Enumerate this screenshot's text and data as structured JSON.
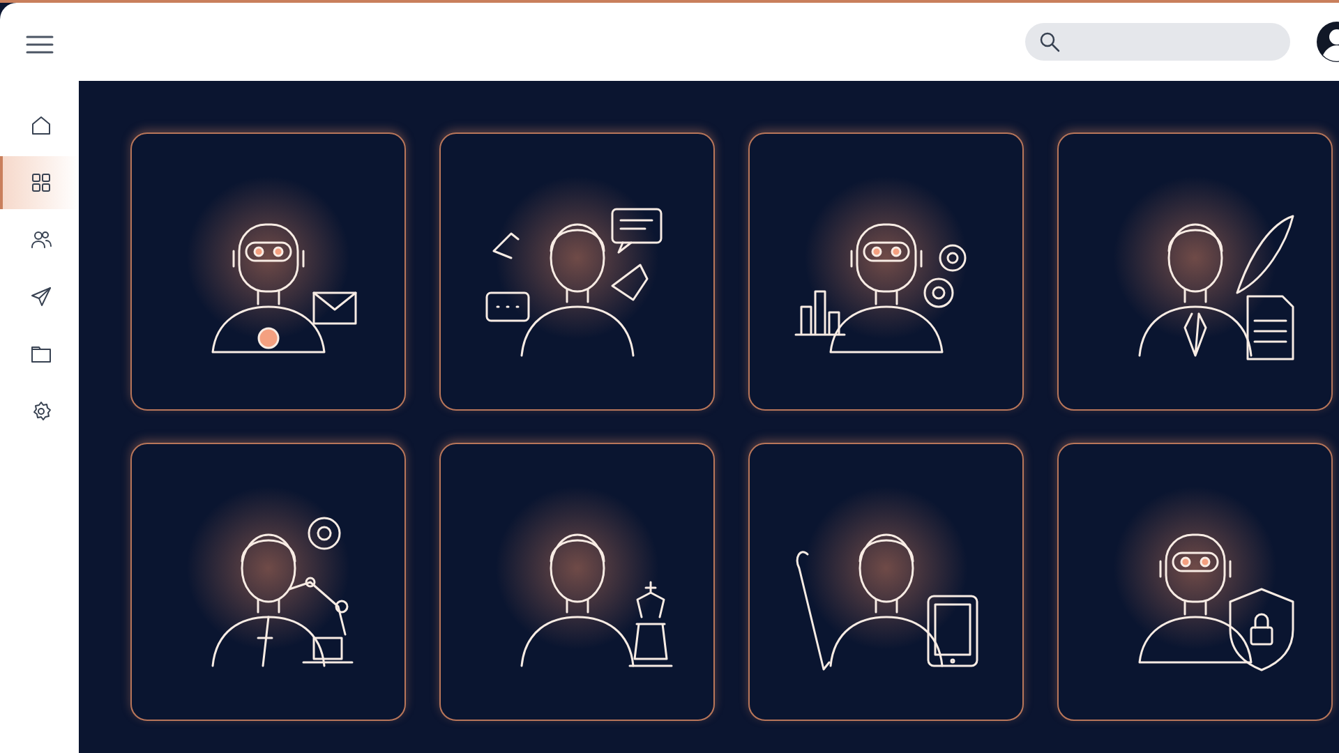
{
  "sidebar": {
    "items": [
      {
        "selected": false
      },
      {
        "selected": true
      },
      {
        "selected": false
      },
      {
        "selected": false
      },
      {
        "selected": false
      },
      {
        "selected": false
      }
    ]
  }
}
